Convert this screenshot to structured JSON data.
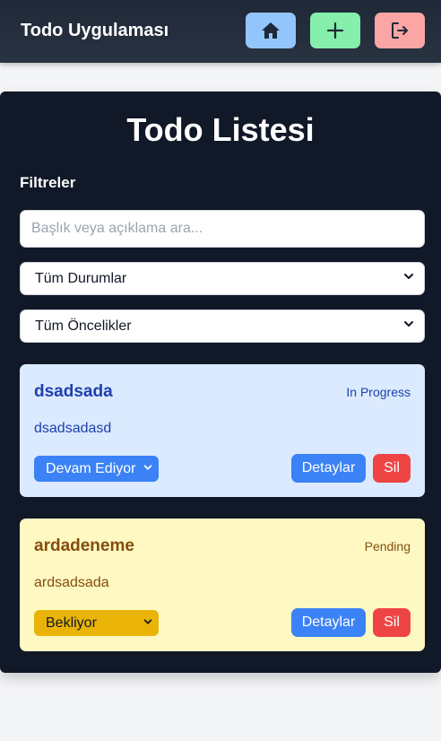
{
  "header": {
    "brand": "Todo Uygulaması",
    "nav": [
      {
        "icon": "home-icon",
        "color": "#93c5fd"
      },
      {
        "icon": "plus-icon",
        "color": "#86efac"
      },
      {
        "icon": "logout-icon",
        "color": "#fca5a5"
      }
    ]
  },
  "main": {
    "title": "Todo Listesi",
    "filters": {
      "heading": "Filtreler",
      "search_placeholder": "Başlık veya açıklama ara...",
      "status_selected": "Tüm Durumlar",
      "priority_selected": "Tüm Öncelikler"
    },
    "todos": [
      {
        "title": "dsadsada",
        "status": "In Progress",
        "description": "dsadsadasd",
        "status_select": "Devam Ediyor",
        "detail_label": "Detaylar",
        "delete_label": "Sil",
        "card_color": "#dbeafe"
      },
      {
        "title": "ardadeneme",
        "status": "Pending",
        "description": "ardsadsada",
        "status_select": "Bekliyor",
        "detail_label": "Detaylar",
        "delete_label": "Sil",
        "card_color": "#fef9c3"
      }
    ]
  },
  "colors": {
    "header_bg": "#1f2937",
    "panel_bg": "#111827",
    "page_bg": "#f3f4f6",
    "primary": "#3b82f6",
    "danger": "#ef4444",
    "warning": "#eab308"
  }
}
